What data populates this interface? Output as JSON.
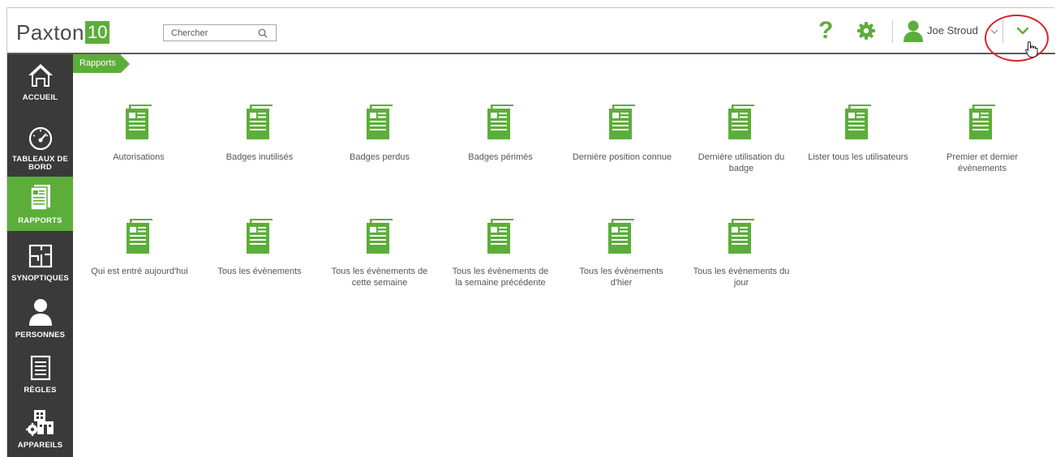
{
  "app": {
    "logo_text": "Paxton",
    "logo_version": "10"
  },
  "header": {
    "search_placeholder": "Chercher",
    "help_label": "?",
    "user_name": "Joe Stroud"
  },
  "sidebar": {
    "items": [
      {
        "label": "ACCUEIL",
        "icon": "home-icon",
        "active": false
      },
      {
        "label": "TABLEAUX DE BORD",
        "icon": "dashboard-icon",
        "active": false
      },
      {
        "label": "RAPPORTS",
        "icon": "report-icon",
        "active": true
      },
      {
        "label": "SYNOPTIQUES",
        "icon": "floorplan-icon",
        "active": false
      },
      {
        "label": "PERSONNES",
        "icon": "person-icon",
        "active": false
      },
      {
        "label": "RÈGLES",
        "icon": "rules-icon",
        "active": false
      },
      {
        "label": "APPAREILS",
        "icon": "devices-icon",
        "active": false
      }
    ]
  },
  "breadcrumb": {
    "current": "Rapports"
  },
  "reports": [
    {
      "label": "Autorisations"
    },
    {
      "label": "Badges inutilisés"
    },
    {
      "label": "Badges perdus"
    },
    {
      "label": "Badges périmés"
    },
    {
      "label": "Dernière position connue"
    },
    {
      "label": "Dernière utilisation du badge"
    },
    {
      "label": "Lister tous les utilisateurs"
    },
    {
      "label": "Premier et dernier évènements"
    },
    {
      "label": "Qui est entré aujourd'hui"
    },
    {
      "label": "Tous les évènements"
    },
    {
      "label": "Tous les évènements de cette semaine"
    },
    {
      "label": "Tous les évènements de la semaine précédente"
    },
    {
      "label": "Tous les évènements d'hier"
    },
    {
      "label": "Tous les évènements du jour"
    }
  ],
  "colors": {
    "brand_green": "#5cae3a",
    "sidebar_bg": "#3a3a3a",
    "highlight_ring": "#d9222a"
  }
}
